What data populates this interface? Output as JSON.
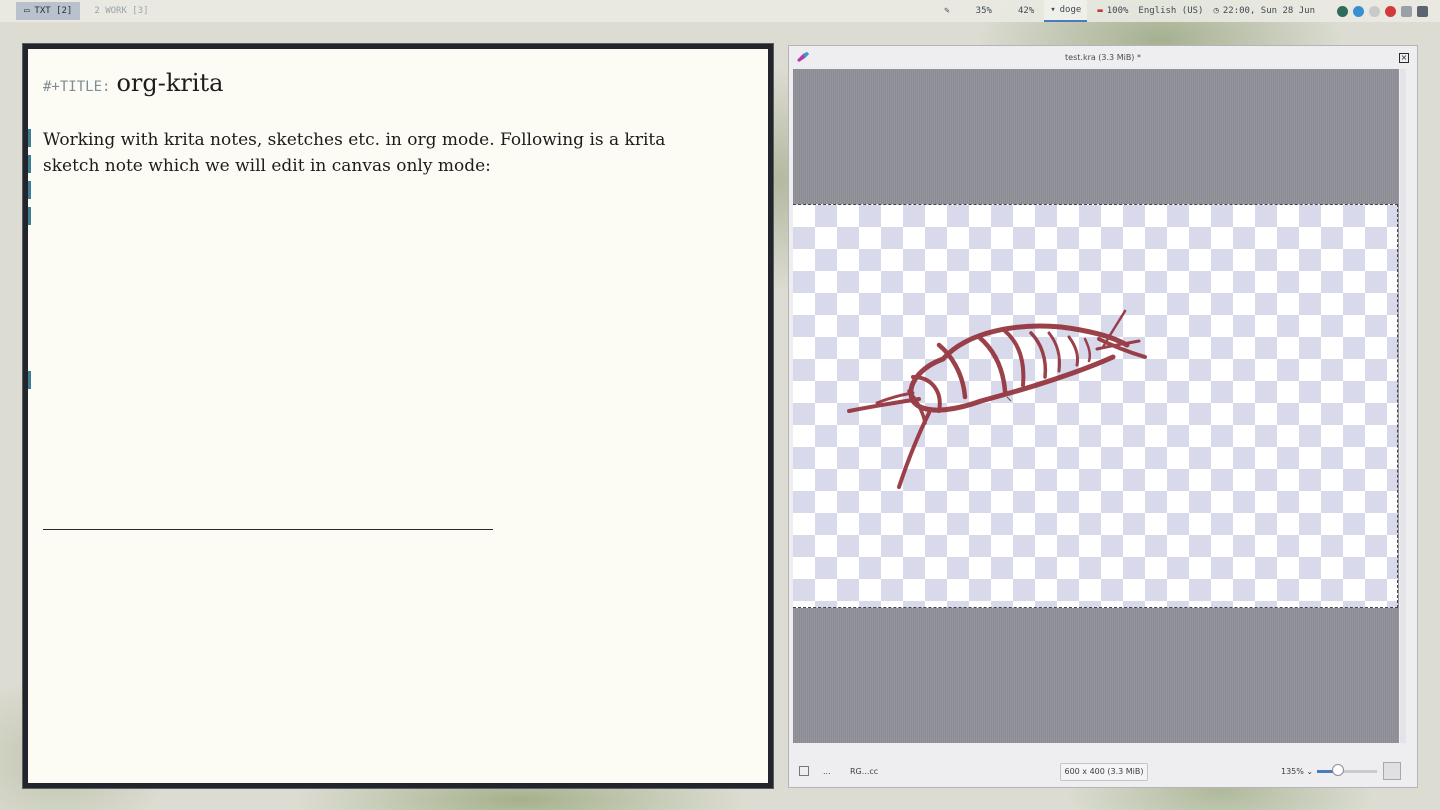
{
  "topbar": {
    "workspace_tag": "TXT [2]",
    "workspace_dim": "2 WORK [3]",
    "cpu": "35%",
    "mem": "42%",
    "host": "doge",
    "battery": "100%",
    "keyboard": "English (US)",
    "clock": "22:00, Sun 28 Jun"
  },
  "org": {
    "keyword": "#+TITLE:",
    "title": "org-krita",
    "paragraph": "Working with krita notes, sketches etc. in org mode. Following is a krita sketch note which we will edit in canvas only mode:"
  },
  "krita": {
    "window_title": "test.kra (3.3 MiB) *",
    "status": {
      "dots": "...",
      "color_model": "RG...cc",
      "image_size": "600 x 400 (3.3 MiB)",
      "zoom": "135%",
      "zoom_value": 0.35
    },
    "brush_color": "#93313b"
  },
  "colors": {
    "accent": "#4a7ac0",
    "org_fringe": "#3f7f95"
  }
}
